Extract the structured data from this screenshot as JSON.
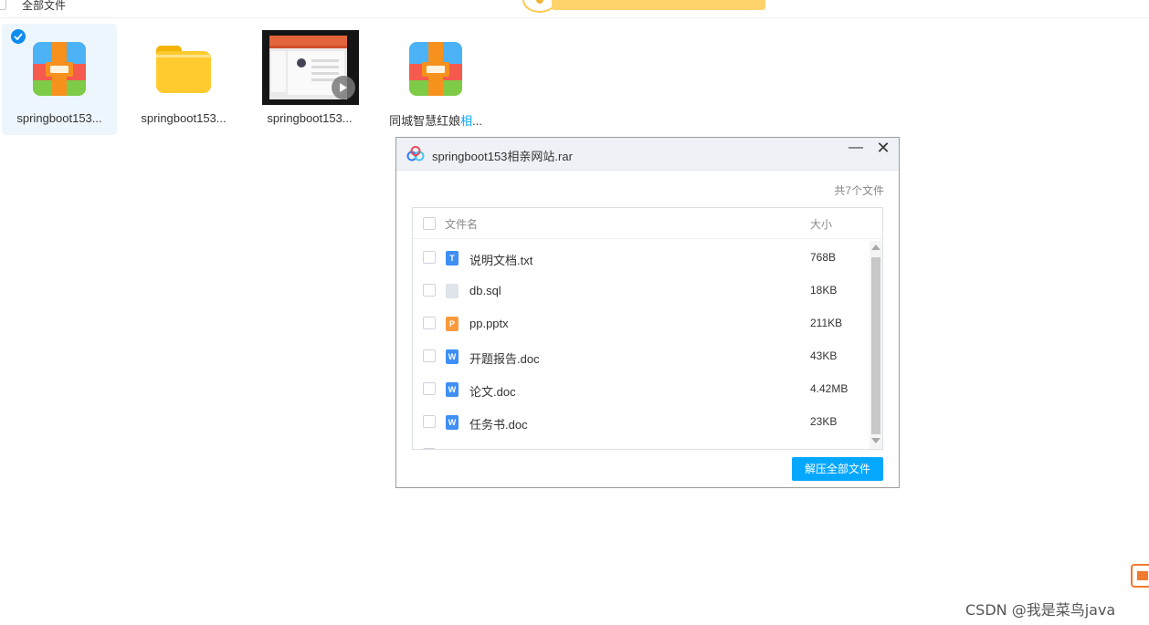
{
  "top": {
    "all_files_label": "全部文件"
  },
  "files": [
    {
      "name": "springboot153...",
      "type": "rar",
      "selected": true
    },
    {
      "name": "springboot153...",
      "type": "folder",
      "selected": false
    },
    {
      "name": "springboot153...",
      "type": "video",
      "selected": false
    },
    {
      "name_prefix": "同城智慧红娘",
      "name_highlight": "相",
      "name_suffix": "...",
      "type": "rar",
      "selected": false
    }
  ],
  "dialog": {
    "title": "springboot153相亲网站.rar",
    "minimize": "—",
    "close": "✕",
    "count": "共7个文件",
    "col_name": "文件名",
    "col_size": "大小",
    "rows": [
      {
        "icon": "T",
        "name": "说明文档.txt",
        "size": "768B"
      },
      {
        "icon": "",
        "name": "db.sql",
        "size": "18KB"
      },
      {
        "icon": "P",
        "name": "pp.pptx",
        "size": "211KB"
      },
      {
        "icon": "W",
        "name": "开题报告.doc",
        "size": "43KB"
      },
      {
        "icon": "W",
        "name": "论文.doc",
        "size": "4.42MB"
      },
      {
        "icon": "W",
        "name": "任务书.doc",
        "size": "23KB"
      },
      {
        "icon": "",
        "name": "",
        "size": ""
      }
    ],
    "extract_all": "解压全部文件"
  },
  "watermark": "CSDN @我是菜鸟java",
  "colors": {
    "accent": "#06a7ff",
    "check": "#0e8cf0"
  }
}
